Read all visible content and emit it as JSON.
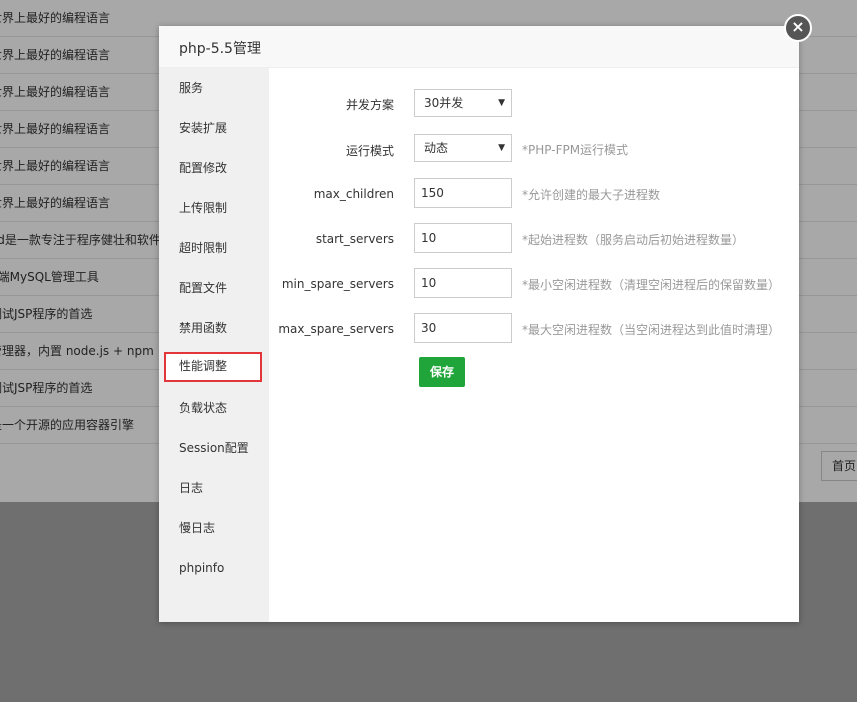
{
  "background": {
    "rows": [
      "世界上最好的编程语言",
      "世界上最好的编程语言",
      "世界上最好的编程语言",
      "世界上最好的编程语言",
      "世界上最好的编程语言",
      "世界上最好的编程语言",
      "Pd是一款专注于程序健壮和软件",
      "b端MySQL管理工具",
      "调试JSP程序的首选",
      "管理器，内置 node.js + npm",
      "调试JSP程序的首选",
      "是一个开源的应用容器引擎"
    ],
    "pager_label": "首页"
  },
  "modal": {
    "title": "php-5.5管理",
    "close_icon": "×",
    "sidebar": {
      "items": [
        {
          "label": "服务"
        },
        {
          "label": "安装扩展"
        },
        {
          "label": "配置修改"
        },
        {
          "label": "上传限制"
        },
        {
          "label": "超时限制"
        },
        {
          "label": "配置文件"
        },
        {
          "label": "禁用函数"
        },
        {
          "label": "性能调整"
        },
        {
          "label": "负载状态"
        },
        {
          "label": "Session配置"
        },
        {
          "label": "日志"
        },
        {
          "label": "慢日志"
        },
        {
          "label": "phpinfo"
        }
      ],
      "active_index": 7
    },
    "form": {
      "concurrency": {
        "label": "并发方案",
        "value": "30并发"
      },
      "run_mode": {
        "label": "运行模式",
        "value": "动态",
        "hint": "*PHP-FPM运行模式"
      },
      "max_children": {
        "label": "max_children",
        "value": "150",
        "hint": "*允许创建的最大子进程数"
      },
      "start_servers": {
        "label": "start_servers",
        "value": "10",
        "hint": "*起始进程数（服务启动后初始进程数量）"
      },
      "min_spare_servers": {
        "label": "min_spare_servers",
        "value": "10",
        "hint": "*最小空闲进程数（清理空闲进程后的保留数量）"
      },
      "max_spare_servers": {
        "label": "max_spare_servers",
        "value": "30",
        "hint": "*最大空闲进程数（当空闲进程达到此值时清理）"
      },
      "save_label": "保存"
    }
  },
  "colors": {
    "accent_green": "#20a53a",
    "highlight_red": "#e3363a",
    "sidebar_bg": "#f0f0f0"
  }
}
